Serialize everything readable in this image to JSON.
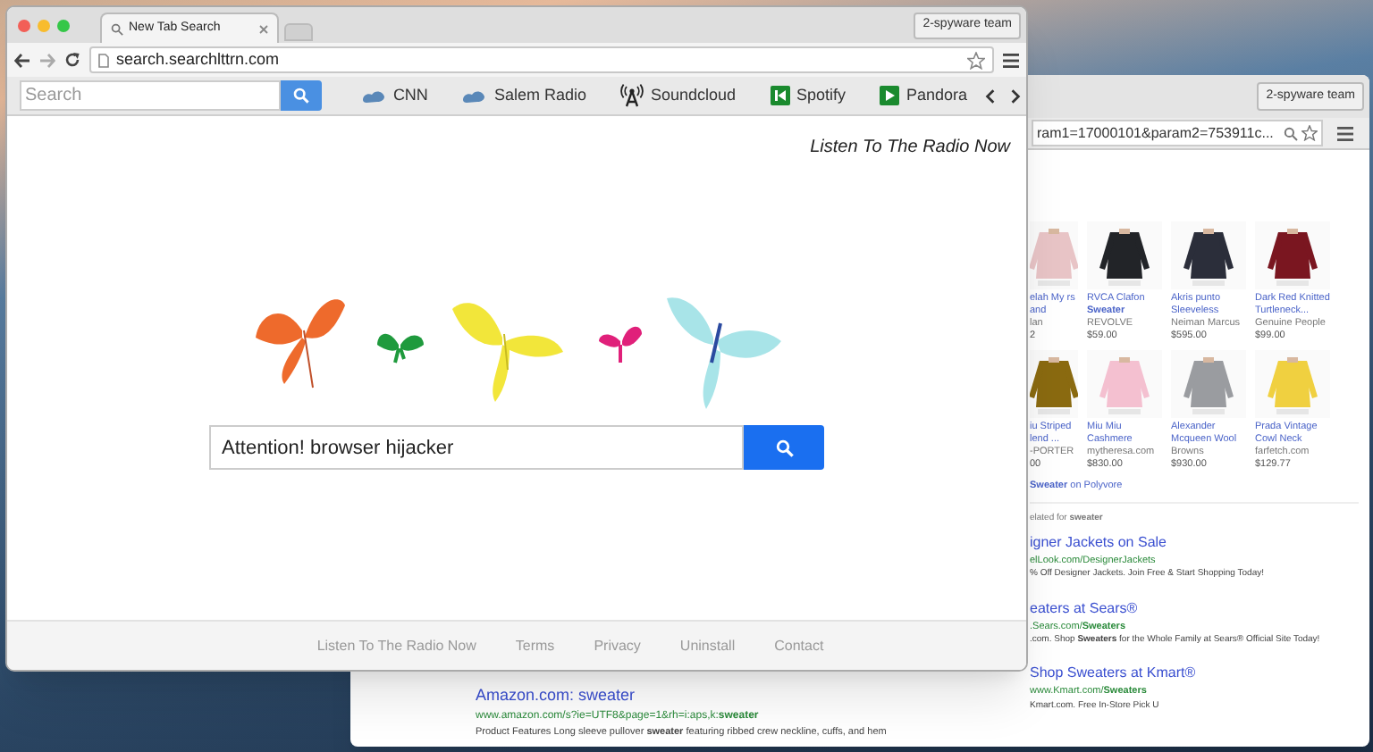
{
  "back_window": {
    "profile_button": "2-spyware team",
    "address": "ram1=17000101&param2=753911c...",
    "products": [
      {
        "name": "elah My rs and",
        "seller": "lan",
        "price": "2"
      },
      {
        "name": "RVCA Clafon **Sweater**",
        "seller": "REVOLVE",
        "price": "$59.00"
      },
      {
        "name": "Akris punto Sleeveless",
        "seller": "Neiman Marcus",
        "price": "$595.00"
      },
      {
        "name": "Dark Red Knitted Turtleneck...",
        "seller": "Genuine People",
        "price": "$99.00"
      },
      {
        "name": "iu Striped lend ...",
        "seller": "-PORTER",
        "price": "00"
      },
      {
        "name": "Miu Miu Cashmere",
        "seller": "mytheresa.com",
        "price": "$830.00"
      },
      {
        "name": "Alexander Mcqueen Wool",
        "seller": "Browns",
        "price": "$930.00"
      },
      {
        "name": "Prada Vintage Cowl Neck",
        "seller": "farfetch.com",
        "price": "$129.77"
      }
    ],
    "polyvore": "**Sweater** on Polyvore",
    "related": "elated for **sweater**",
    "ads": [
      {
        "title": "igner Jackets on Sale",
        "url": "elLook.com/DesignerJackets",
        "desc": "% Off Designer Jackets. Join Free & Start Shopping Today!"
      },
      {
        "title": "eaters at Sears®",
        "url": ".Sears.com/**Sweaters**",
        "desc": ".com. Shop **Sweaters** for the Whole Family at Sears® Official Site Today!"
      },
      {
        "title": "Shop Sweaters at Kmart®",
        "url": "www.Kmart.com/**Sweaters**",
        "desc": "Kmart.com. Free In-Store Pick U"
      }
    ],
    "results": [
      {
        "title": "Amazon.com: sweater",
        "url": "www.amazon.com/s?ie=UTF8&page=1&rh=i:aps,k:**sweater**",
        "desc": "Product Features Long sleeve pullover **sweater** featuring ribbed crew neckline, cuffs, and hem"
      }
    ]
  },
  "front_window": {
    "tabs": [
      {
        "title": "New Tab Search",
        "selected": true
      }
    ],
    "profile_button": "2-spyware team",
    "address": "search.searchlttrn.com",
    "toolbar": {
      "search_placeholder": "Search",
      "links": [
        {
          "label": "CNN",
          "kind": "cloud"
        },
        {
          "label": "Salem Radio",
          "kind": "cloud"
        },
        {
          "label": "Soundcloud",
          "kind": "antenna"
        },
        {
          "label": "Spotify",
          "kind": "rewind"
        },
        {
          "label": "Pandora",
          "kind": "play"
        }
      ]
    },
    "radio_link": "Listen To The Radio Now",
    "search": {
      "value": "Attention! browser hijacker"
    },
    "footer_links": [
      "Listen To The Radio Now",
      "Terms",
      "Privacy",
      "Uninstall",
      "Contact"
    ]
  }
}
